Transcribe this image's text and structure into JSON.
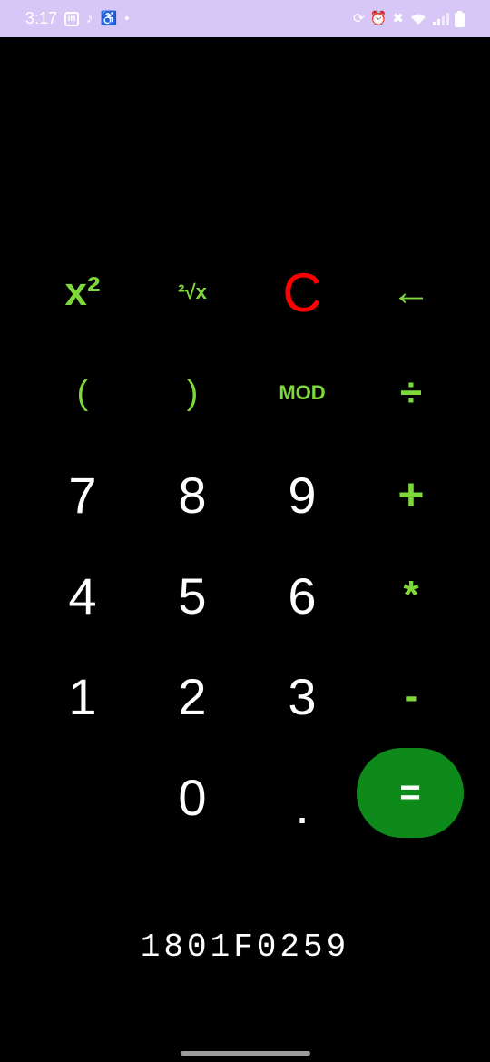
{
  "status_bar": {
    "time": "3:17",
    "left_icons": [
      "linkedin-icon",
      "tiktok-icon",
      "accessibility-icon",
      "notification-dot-icon"
    ],
    "right_icons": [
      "sync-icon",
      "alarm-icon",
      "mute-icon",
      "wifi-icon",
      "signal-icon",
      "battery-icon"
    ],
    "background": "#d6c7f7"
  },
  "keys": {
    "square": "x²",
    "sqrt": "²√x",
    "clear": "C",
    "backspace": "←",
    "open_paren": "(",
    "close_paren": ")",
    "mod": "MOD",
    "divide": "÷",
    "seven": "7",
    "eight": "8",
    "nine": "9",
    "plus": "+",
    "four": "4",
    "five": "5",
    "six": "6",
    "multiply": "*",
    "one": "1",
    "two": "2",
    "three": "3",
    "minus": "-",
    "zero": "0",
    "dot": ".",
    "equals": "="
  },
  "display": {
    "value": "1801F0259"
  },
  "colors": {
    "function_keys": "#7fd83a",
    "clear_key": "#ff0000",
    "digits": "#ffffff",
    "equals_button": "#0e8a1a",
    "background": "#000000"
  }
}
